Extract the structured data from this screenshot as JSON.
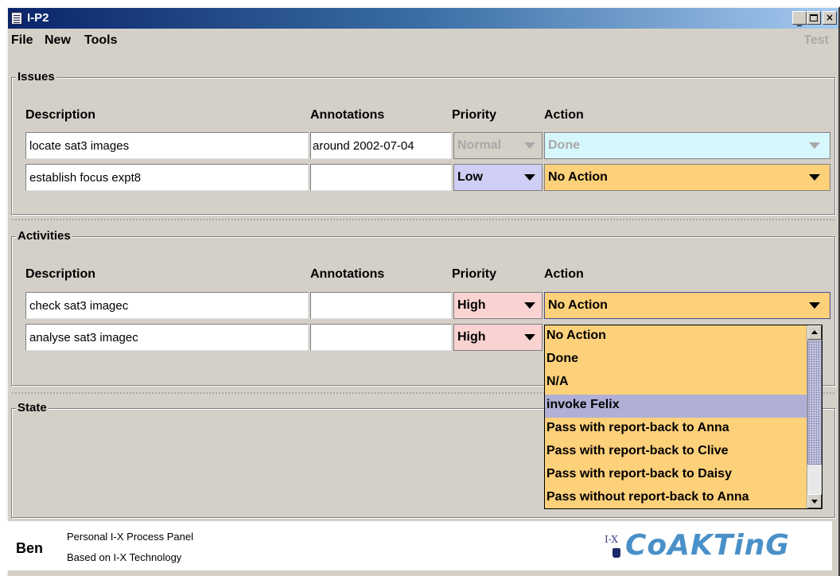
{
  "window": {
    "title": "I-P2"
  },
  "menubar": {
    "file": "File",
    "new": "New",
    "tools": "Tools",
    "test": "Test"
  },
  "headers": {
    "description": "Description",
    "annotations": "Annotations",
    "priority": "Priority",
    "action": "Action"
  },
  "issues": {
    "label": "Issues",
    "rows": [
      {
        "description": "locate sat3 images",
        "annotations": "around 2002-07-04",
        "priority": "Normal",
        "action": "Done",
        "disabled": true
      },
      {
        "description": "establish focus expt8",
        "annotations": "",
        "priority": "Low",
        "action": "No Action",
        "disabled": false
      }
    ]
  },
  "activities": {
    "label": "Activities",
    "rows": [
      {
        "description": "check sat3 imagec",
        "annotations": "",
        "priority": "High",
        "action": "No Action"
      },
      {
        "description": "analyse sat3 imagec",
        "annotations": "",
        "priority": "High",
        "action": ""
      }
    ]
  },
  "action_dropdown": {
    "options": [
      "No Action",
      "Done",
      "N/A",
      "invoke Felix",
      "Pass with report-back to Anna",
      "Pass with report-back to Clive",
      "Pass with report-back to Daisy",
      "Pass without report-back to Anna"
    ],
    "highlighted": "invoke Felix"
  },
  "state": {
    "label": "State"
  },
  "footer": {
    "user": "Ben",
    "line1": "Personal I-X Process Panel",
    "line2": "Based on I-X Technology",
    "logo_small": "I-X",
    "logo_text": "CoAKTinG"
  },
  "colors": {
    "action_bg": "#fdd07a",
    "priority_low": "#cfcff5",
    "priority_high": "#fbd2d2",
    "done_bg": "#d6f7fb",
    "selected_item": "#b0b0d6"
  }
}
